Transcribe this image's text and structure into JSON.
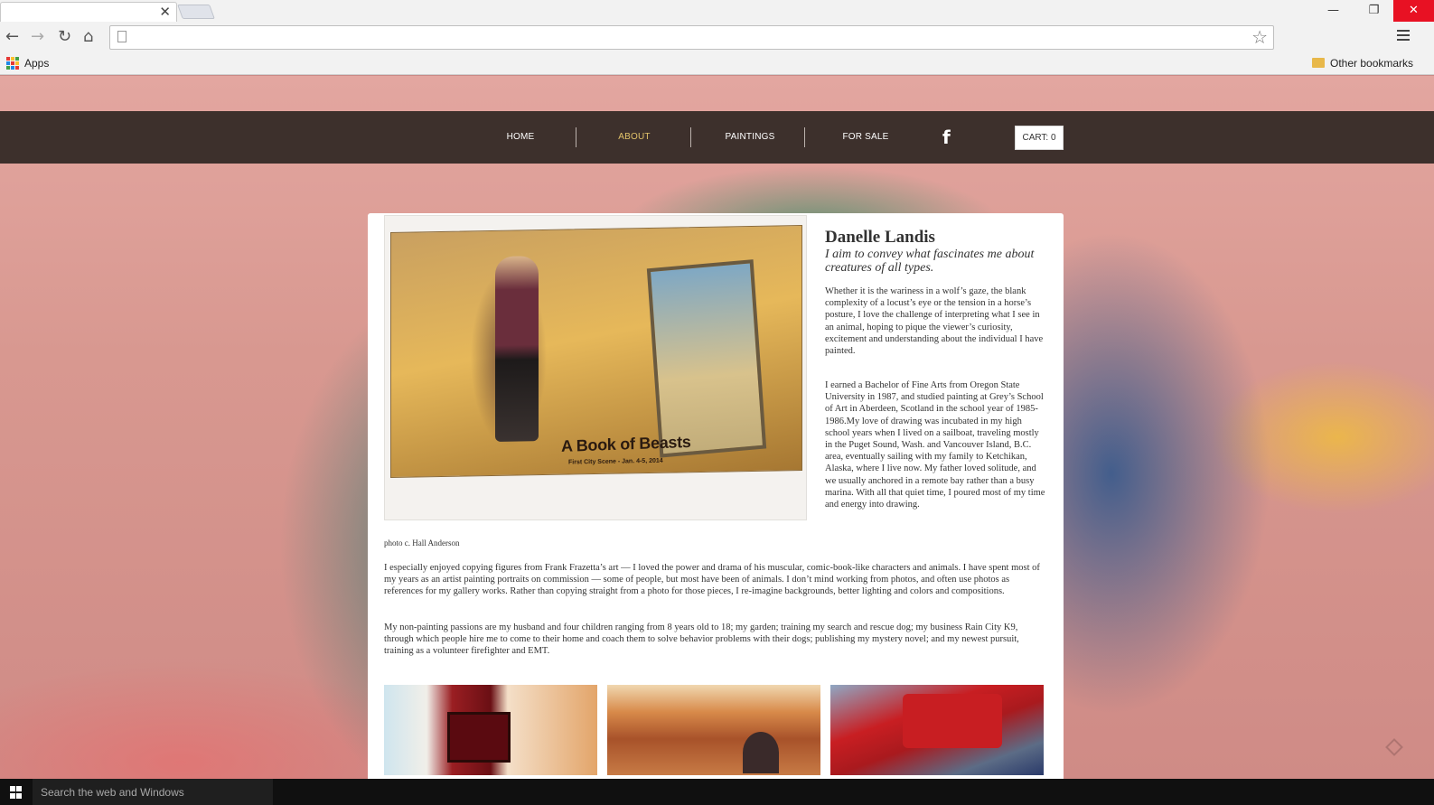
{
  "browser": {
    "tab_close_glyph": "✕",
    "window_controls": {
      "minimize": "—",
      "restore": "❐",
      "close": "✕"
    },
    "toolbar": {
      "back_glyph": "←",
      "forward_glyph": "→",
      "reload_glyph": "↻",
      "home_glyph": "⌂",
      "address_value": "",
      "star_glyph": "☆"
    },
    "bookmarks": {
      "apps_label": "Apps",
      "apps_colors": [
        "#e53935",
        "#fbc02d",
        "#43a047",
        "#1e88e5",
        "#e53935",
        "#fbc02d",
        "#43a047",
        "#1e88e5",
        "#e53935"
      ],
      "other_label": "Other bookmarks"
    }
  },
  "site": {
    "nav": {
      "home": "HOME",
      "about": "ABOUT",
      "paintings": "PAINTINGS",
      "for_sale": "FOR SALE",
      "facebook_glyph": "f",
      "cart": "CART: 0",
      "active_color": "#e2c36a",
      "bar_color": "#3d302c"
    },
    "hero": {
      "caption_title": "A Book of Beasts",
      "caption_sub": "First City Scene - Jan. 4-5, 2014",
      "photo_credit": "photo c. Hall Anderson"
    },
    "bio": {
      "name": "Danelle Landis",
      "tagline": "I aim to convey what fascinates me about creatures of all types.",
      "p1": "Whether it is the wariness in a wolf’s gaze, the blank complexity of a locust’s eye or the tension in a horse’s posture, I love the challenge of interpreting what I see in an animal, hoping to pique the viewer’s curiosity, excitement and understanding about the individual I have painted.",
      "p2": "I earned a Bachelor of Fine Arts from Oregon State University in 1987, and studied painting at Grey’s School of Art in Aberdeen, Scotland in the school year of 1985-1986.My love of drawing was incubated in my high school years when I lived on a sailboat, traveling mostly in the Puget Sound, Wash. and Vancouver Island, B.C. area, eventually sailing with my family to Ketchikan, Alaska, where I live now. My father loved solitude, and we usually anchored in a remote bay rather than a busy marina. With all that quiet time, I poured most of my time and energy into drawing.",
      "p3": " I especially enjoyed copying figures from Frank Frazetta’s art — I loved the power and drama of his muscular, comic-book-like characters and animals. I have spent most of my years as an artist painting portraits on commission — some of people, but most have been of animals. I don’t mind working from photos, and often use photos as references for my gallery works. Rather than copying straight from a photo for those pieces, I re-imagine backgrounds, better lighting and colors and compositions.",
      "p4": "My non-painting passions are my husband and four children ranging from 8 years old to 18; my garden; training my search and rescue dog; my business Rain City K9, through which people hire me to come to their home and coach them to solve behavior problems with their dogs; publishing my mystery novel; and my newest pursuit, training as a volunteer firefighter and EMT."
    }
  },
  "taskbar": {
    "search_placeholder": "Search the web and Windows"
  }
}
